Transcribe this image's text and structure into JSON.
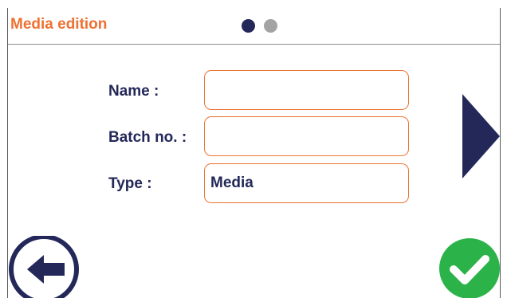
{
  "header": {
    "title": "Media edition",
    "pager": {
      "total": 2,
      "active": 1
    }
  },
  "form": {
    "name": {
      "label": "Name :",
      "value": "",
      "placeholder": ""
    },
    "batch": {
      "label": "Batch no.  :",
      "value": "",
      "placeholder": ""
    },
    "type": {
      "label": "Type :",
      "value": "Media",
      "placeholder": ""
    }
  },
  "icons": {
    "next": "chevron-right-icon",
    "back": "arrow-left-circle-icon",
    "confirm": "checkmark-circle-icon"
  },
  "colors": {
    "accent": "#ee7132",
    "primary": "#232859",
    "inactive": "#a3a3a3",
    "confirm": "#2bb34a",
    "background": "#ffffff"
  }
}
